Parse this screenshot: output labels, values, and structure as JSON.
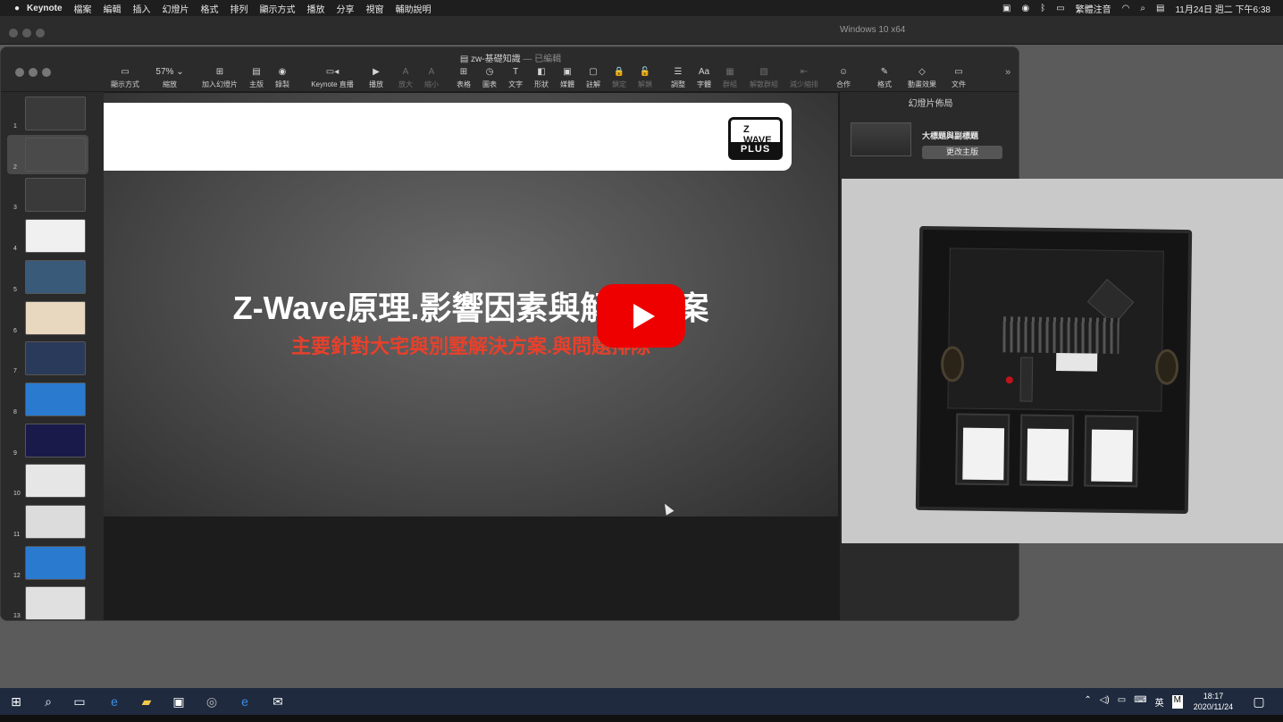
{
  "menubar": {
    "app_name": "Keynote",
    "items": [
      "檔案",
      "編輯",
      "插入",
      "幻燈片",
      "格式",
      "排列",
      "顯示方式",
      "播放",
      "分享",
      "視窗",
      "輔助說明"
    ],
    "input_method": "繁體注音",
    "datetime": "11月24日 週二 下午6:38"
  },
  "host": {
    "vm_title": "Windows 10 x64"
  },
  "keynote": {
    "doc_title": "zw-基礎知識",
    "doc_status": "— 已編輯",
    "toolbar": [
      {
        "label": "顯示方式",
        "icon": "▭",
        "dim": false
      },
      {
        "label": "縮放",
        "icon": "57% ⌄",
        "dim": false
      },
      {
        "label": "加入幻燈片",
        "icon": "⊞",
        "dim": false
      },
      {
        "label": "主版",
        "icon": "▤",
        "dim": false
      },
      {
        "label": "錄製",
        "icon": "◉",
        "dim": false
      },
      {
        "label": "Keynote 直播",
        "icon": "▭◂",
        "dim": false
      },
      {
        "label": "播放",
        "icon": "▶",
        "dim": false
      },
      {
        "label": "放大",
        "icon": "A",
        "dim": true
      },
      {
        "label": "縮小",
        "icon": "A",
        "dim": true
      },
      {
        "label": "表格",
        "icon": "⊞",
        "dim": false
      },
      {
        "label": "圖表",
        "icon": "◷",
        "dim": false
      },
      {
        "label": "文字",
        "icon": "T",
        "dim": false
      },
      {
        "label": "形狀",
        "icon": "◧",
        "dim": false
      },
      {
        "label": "媒體",
        "icon": "▣",
        "dim": false
      },
      {
        "label": "註解",
        "icon": "▢",
        "dim": false
      },
      {
        "label": "鎖定",
        "icon": "🔒",
        "dim": true
      },
      {
        "label": "解鎖",
        "icon": "🔓",
        "dim": true
      },
      {
        "label": "調整",
        "icon": "☰",
        "dim": false
      },
      {
        "label": "字體",
        "icon": "Aa",
        "dim": false
      },
      {
        "label": "群組",
        "icon": "▦",
        "dim": true
      },
      {
        "label": "解散群組",
        "icon": "▧",
        "dim": true
      },
      {
        "label": "減少縮排",
        "icon": "⇤",
        "dim": true
      },
      {
        "label": "合作",
        "icon": "☺",
        "dim": false
      },
      {
        "label": "格式",
        "icon": "✎",
        "dim": false
      },
      {
        "label": "動畫效果",
        "icon": "◇",
        "dim": false
      },
      {
        "label": "文件",
        "icon": "▭",
        "dim": false
      }
    ],
    "slides": [
      "1",
      "2",
      "3",
      "4",
      "5",
      "6",
      "7",
      "8",
      "9",
      "10",
      "11",
      "12",
      "13"
    ],
    "selected_slide": 2,
    "slide": {
      "title": "Z-Wave原理.影響因素與解決方案",
      "subtitle": "主要針對大宅與別墅解決方案.與問題排除",
      "logo_top": "Z WAVE",
      "logo_bottom": "PLUS"
    },
    "inspector": {
      "heading": "幻燈片佈局",
      "layout_name": "大標題與副標題",
      "change_master": "更改主版"
    }
  },
  "taskbar": {
    "time": "18:17",
    "date": "2020/11/24",
    "ime": "英",
    "ime2": "M"
  },
  "colors": {
    "subtitle_red": "#e8402b",
    "play_red": "#ee0000",
    "taskbar": "#1f2a3f"
  }
}
